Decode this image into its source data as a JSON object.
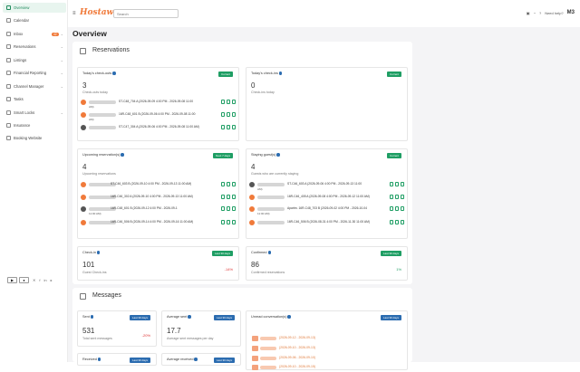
{
  "sidebar": {
    "items": [
      {
        "label": "Overview"
      },
      {
        "label": "Calendar"
      },
      {
        "label": "Inbox",
        "badge": "42"
      },
      {
        "label": "Reservations"
      },
      {
        "label": "Listings"
      },
      {
        "label": "Financial Reporting"
      },
      {
        "label": "Channel Manager"
      },
      {
        "label": "Tasks"
      },
      {
        "label": "Smart Locks"
      },
      {
        "label": "Insurance"
      },
      {
        "label": "Booking Website"
      }
    ]
  },
  "topbar": {
    "brand": "Hostaway",
    "search_placeholder": "Search",
    "help": "Need help?",
    "avatar": "M3"
  },
  "page_title": "Overview",
  "reservations": {
    "title": "Reservations",
    "checkouts": {
      "label": "Today's check-outs",
      "badge": "Current",
      "count": "3",
      "sub": "Check-outs today",
      "rows": [
        {
          "text": "ST-C48_704 A (2026-09-09 4:00 PM - 2026-09-08 11:00",
          "sub": "AM)"
        },
        {
          "text": "16R-C48_601 B (2026-09-06 4:00 PM - 2026-09-08 11:00",
          "sub": "AM)"
        },
        {
          "text": "ST-C47_304 A (2026-09-06 4:00 PM - 2026-09-08 11:00 AM)",
          "sub": ""
        }
      ]
    },
    "checkins": {
      "label": "Today's check-ins",
      "badge": "Current",
      "count": "0",
      "sub": "Check-ins today"
    },
    "upcoming": {
      "label": "Upcoming reservation(s)",
      "badge": "Next 7 days",
      "count": "4",
      "sub": "Upcoming reservations",
      "rows": [
        {
          "text": "ST-C46_603 B (2026-09-10 4:00 PM - 2026-09-13 11:00 AM)",
          "sub": ""
        },
        {
          "text": "16R-C46_302 A (2026-09-10 4:00 PM - 2026-09-13 11:00 AM)",
          "sub": ""
        },
        {
          "text": "16R-C48_601 B (2026-09-12 4:00 PM - 2026-09-1",
          "sub": "11:00 AM)"
        },
        {
          "text": "16R-C46_506 B (2026-09-14 4:00 PM - 2026-09-16 11:00 AM)",
          "sub": ""
        }
      ]
    },
    "staying": {
      "label": "Staying guest(s)",
      "badge": "Current",
      "count": "4",
      "sub": "Guests who are currently staying",
      "rows": [
        {
          "text": "ST-C46_603 A (2026-09-06 4:00 PM - 2026-09-13 11:00",
          "sub": "AM)"
        },
        {
          "text": "16R-C46_405 A (2026-09-08 4:00 PM - 2026-09-12 11:00 AM)",
          "sub": ""
        },
        {
          "text": "Apartm. 16R-C48_703 B (2026-09-02 4:00 PM - 2026-10-04",
          "sub": "11:00 AM)"
        },
        {
          "text": "16R-C46_506 B (2026-08-31 4:00 PM - 2026-11-30 11:00 AM)",
          "sub": ""
        }
      ]
    },
    "checkin_stat": {
      "label": "Check-in",
      "badge": "Last 30 days",
      "value": "101",
      "sub": "Guest Check-ins",
      "trend": "-14%"
    },
    "confirmed": {
      "label": "Confirmed",
      "badge": "Last 30 days",
      "value": "86",
      "sub": "Confirmed reservations",
      "trend": "1%"
    }
  },
  "messages": {
    "title": "Messages",
    "sent": {
      "label": "Sent",
      "badge": "Last 30 days",
      "value": "531",
      "sub": "Total sent messages",
      "trend": "-20%"
    },
    "avg_sent": {
      "label": "Average sent",
      "badge": "Last 30 days",
      "value": "17.7",
      "sub": "Average sent messages per day"
    },
    "received": {
      "label": "Received",
      "badge": "Last 30 days"
    },
    "avg_received": {
      "label": "Average received",
      "badge": "Last 30 days"
    },
    "unread": {
      "label": "Unread conversation(s)",
      "badge": "Last 30 days",
      "rows": [
        {
          "text": "(2026-09-12 - 2026-09-13)"
        },
        {
          "text": "(2026-09-10 - 2026-09-13)"
        },
        {
          "text": "(2026-09-06 - 2026-09-10)"
        },
        {
          "text": "(2026-09-10 - 2026-09-15)"
        }
      ]
    }
  },
  "colors": {
    "accent": "#1f9e64",
    "brand": "#f07a3a",
    "badge_blue": "#2b6cb0"
  }
}
